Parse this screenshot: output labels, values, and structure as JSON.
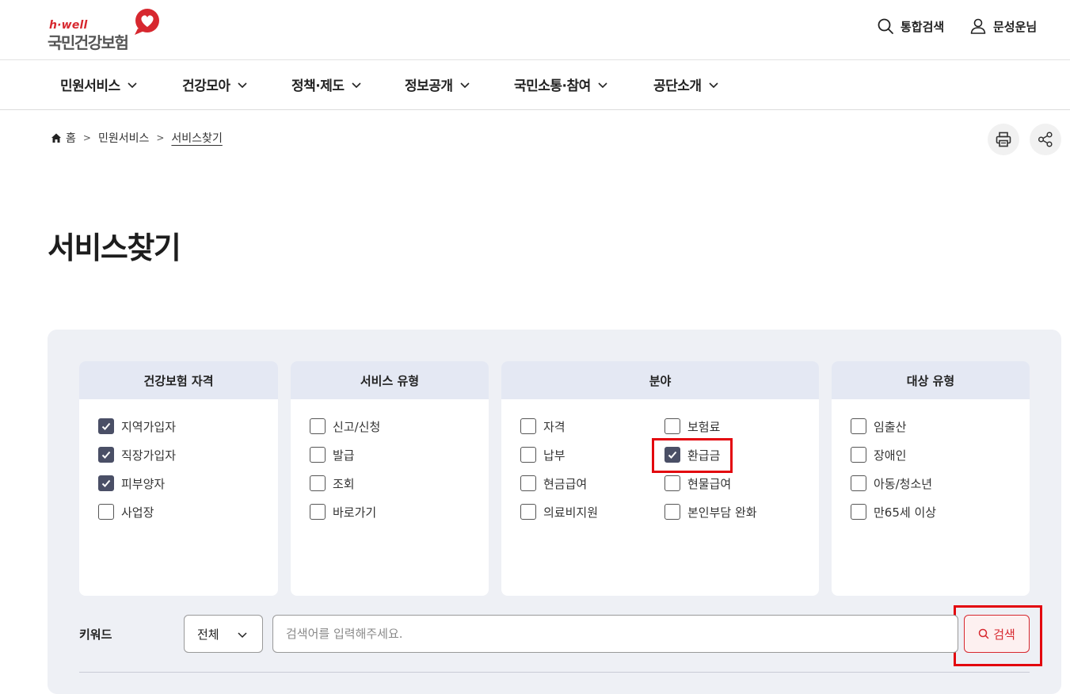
{
  "header": {
    "logo_tag": "h·well",
    "logo_name": "국민건강보험",
    "search_label": "통합검색",
    "user_label": "문성운님"
  },
  "gnb": [
    {
      "label": "민원서비스"
    },
    {
      "label": "건강모아"
    },
    {
      "label": "정책·제도"
    },
    {
      "label": "정보공개"
    },
    {
      "label": "국민소통·참여"
    },
    {
      "label": "공단소개"
    }
  ],
  "breadcrumb": {
    "home": "홈",
    "level1": "민원서비스",
    "current": "서비스찾기"
  },
  "page_title": "서비스찾기",
  "filters": {
    "eligibility": {
      "title": "건강보험 자격",
      "options": [
        {
          "label": "지역가입자",
          "checked": true
        },
        {
          "label": "직장가입자",
          "checked": true
        },
        {
          "label": "피부양자",
          "checked": true
        },
        {
          "label": "사업장",
          "checked": false
        }
      ]
    },
    "service_type": {
      "title": "서비스 유형",
      "options": [
        {
          "label": "신고/신청",
          "checked": false
        },
        {
          "label": "발급",
          "checked": false
        },
        {
          "label": "조회",
          "checked": false
        },
        {
          "label": "바로가기",
          "checked": false
        }
      ]
    },
    "field": {
      "title": "분야",
      "options": [
        {
          "label": "자격",
          "checked": false
        },
        {
          "label": "보험료",
          "checked": false
        },
        {
          "label": "납부",
          "checked": false
        },
        {
          "label": "환급금",
          "checked": true
        },
        {
          "label": "현금급여",
          "checked": false
        },
        {
          "label": "현물급여",
          "checked": false
        },
        {
          "label": "의료비지원",
          "checked": false
        },
        {
          "label": "본인부담 완화",
          "checked": false
        }
      ]
    },
    "target": {
      "title": "대상 유형",
      "options": [
        {
          "label": "임출산",
          "checked": false
        },
        {
          "label": "장애인",
          "checked": false
        },
        {
          "label": "아동/청소년",
          "checked": false
        },
        {
          "label": "만65세 이상",
          "checked": false
        }
      ]
    }
  },
  "keyword": {
    "label": "키워드",
    "select_value": "전체",
    "placeholder": "검색어를 입력해주세요.",
    "value": "",
    "button_label": "검색"
  },
  "colors": {
    "brand": "#d7282f",
    "checkbox_on": "#4a4f66",
    "panel_bg": "#eef0f5",
    "box_head": "#e4e8f3",
    "highlight": "#e3060e"
  }
}
